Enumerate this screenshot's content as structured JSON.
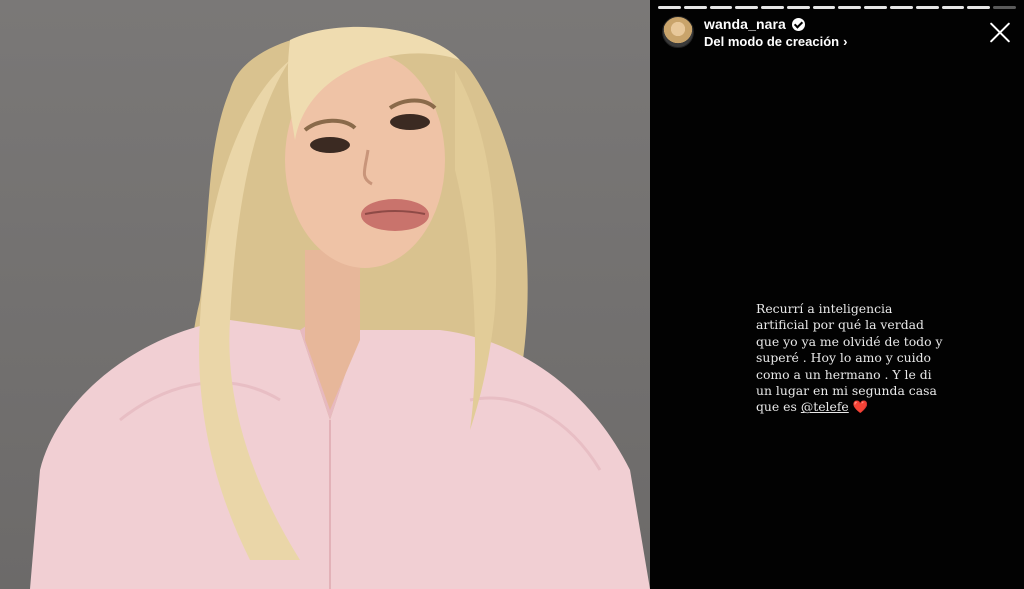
{
  "story": {
    "username": "wanda_nara",
    "subtitle": "Del modo de creación",
    "subtitle_chevron": "›",
    "progress_segments_total": 14,
    "progress_segments_done": 13,
    "text_lines": [
      "Recurrí a inteligencia",
      "artificial por qué la verdad",
      "que yo ya me olvidé de todo y",
      "superé . Hoy lo amo y cuido",
      "como a un hermano . Y le di",
      "un lugar en mi segunda casa"
    ],
    "last_line_prefix": "que es ",
    "mention": "@telefe",
    "heart": "❤️"
  },
  "icons": {
    "verified": "verified-badge-icon",
    "close": "close-icon",
    "heart": "heart-emoji"
  },
  "colors": {
    "background": "#020202",
    "text": "#e9e9e9",
    "heart": "#e0262e",
    "photo_backdrop": "#737170",
    "shirt": "#f1cfd3",
    "hair": "#e8d3a6"
  }
}
